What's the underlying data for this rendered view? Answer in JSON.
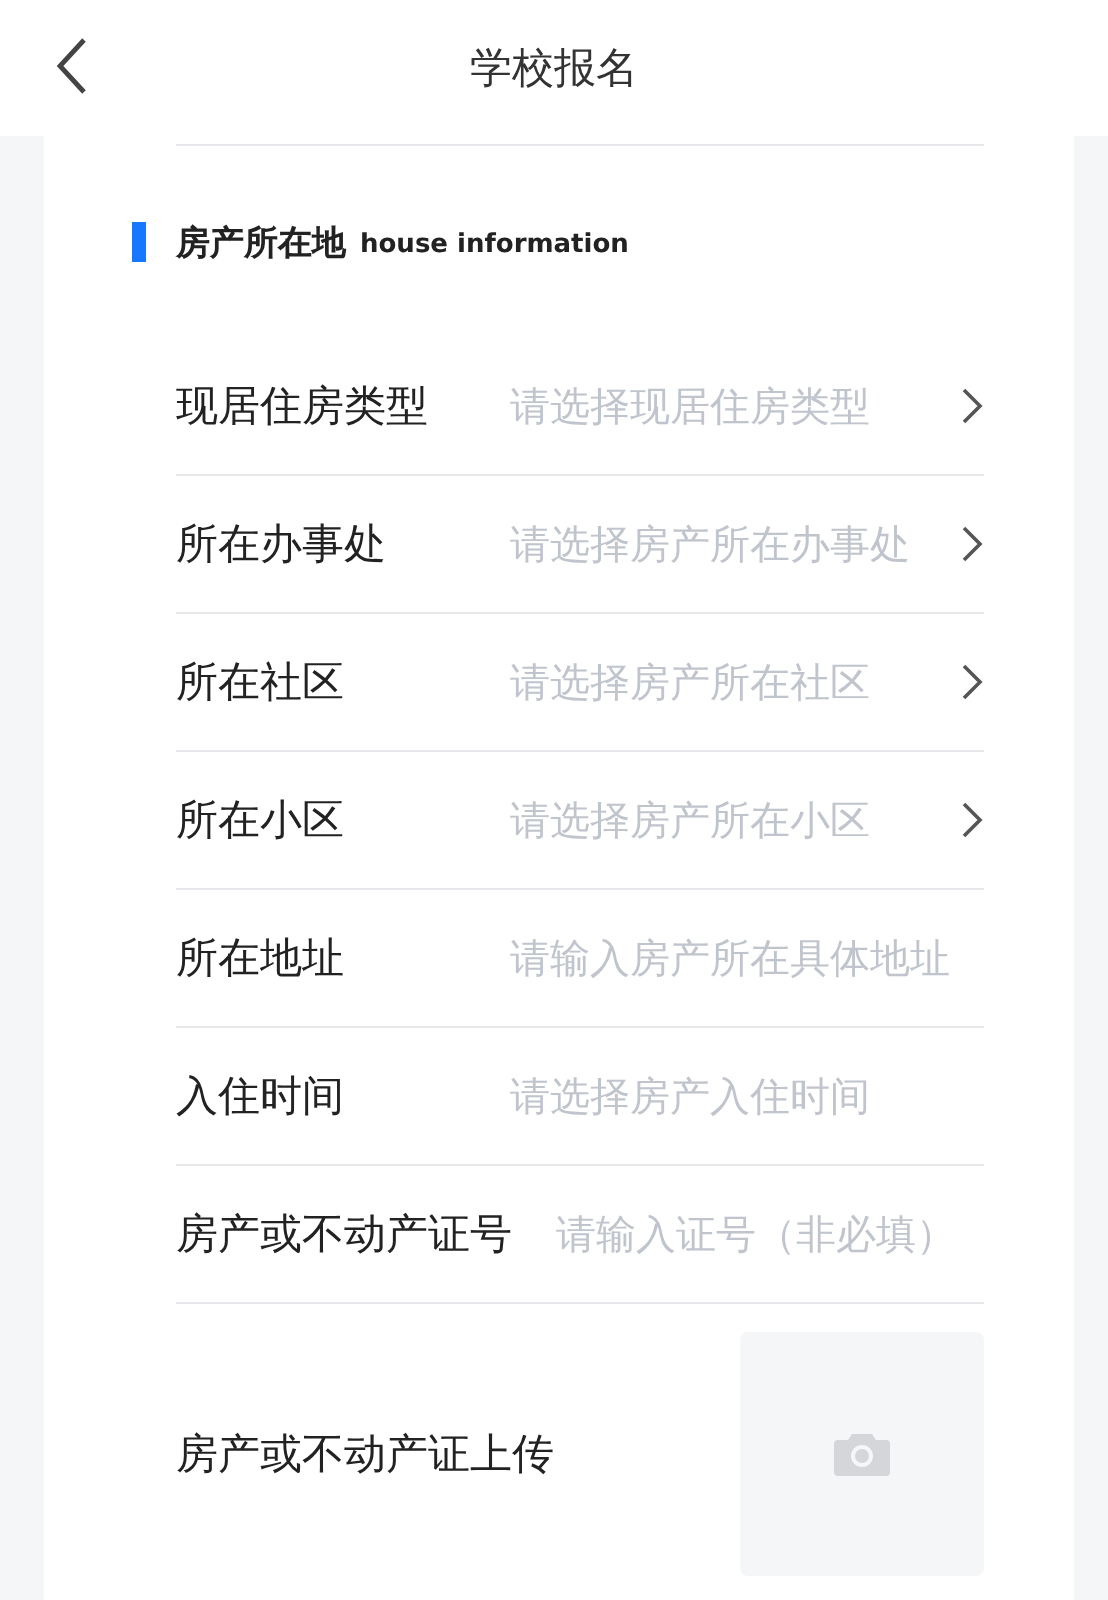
{
  "header": {
    "title": "学校报名"
  },
  "section": {
    "title": "房产所在地",
    "subtitle": "house information"
  },
  "fields": [
    {
      "kind": "select",
      "label": "现居住房类型",
      "placeholder": "请选择现居住房类型"
    },
    {
      "kind": "select",
      "label": "所在办事处",
      "placeholder": "请选择房产所在办事处"
    },
    {
      "kind": "select",
      "label": "所在社区",
      "placeholder": "请选择房产所在社区"
    },
    {
      "kind": "select",
      "label": "所在小区",
      "placeholder": "请选择房产所在小区"
    },
    {
      "kind": "input",
      "label": "所在地址",
      "placeholder": "请输入房产所在具体地址"
    },
    {
      "kind": "input",
      "label": "入住时间",
      "placeholder": "请选择房产入住时间"
    },
    {
      "kind": "input",
      "label": "房产或不动产证号",
      "placeholder": "请输入证号（非必填）"
    },
    {
      "kind": "upload",
      "label": "房产或不动产证上传"
    }
  ]
}
